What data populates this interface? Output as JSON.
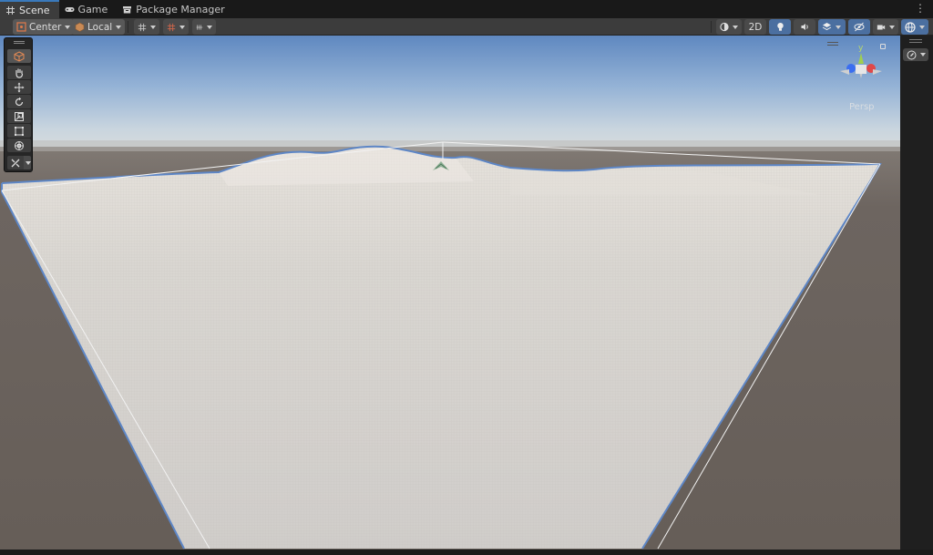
{
  "tabs": [
    {
      "label": "Scene",
      "icon": "grid-icon",
      "active": true
    },
    {
      "label": "Game",
      "icon": "gamepad-icon",
      "active": false
    },
    {
      "label": "Package Manager",
      "icon": "package-icon",
      "active": false
    }
  ],
  "toolbar": {
    "pivot_label": "Center",
    "space_label": "Local",
    "mode_2d_label": "2D"
  },
  "gizmo": {
    "projection_label": "Persp",
    "axis_y_label": "y"
  },
  "colors": {
    "sky_top": "#5f88c0",
    "horizon": "#cdd7df",
    "ground": "#6d6560",
    "terrain": "#d7d4cf",
    "selection_outline": "#5d86c6",
    "accent": "#3a79bb"
  }
}
